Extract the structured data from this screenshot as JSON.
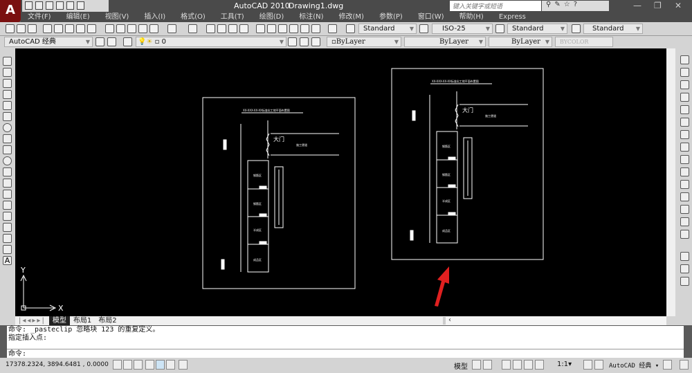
{
  "app": {
    "logo": "A",
    "title": "AutoCAD 2010",
    "document": "Drawing1.dwg"
  },
  "search": {
    "placeholder": "键入关键字或短语"
  },
  "window_controls": {
    "minimize": "—",
    "restore": "❐",
    "close": "✕"
  },
  "menu": [
    "文件(F)",
    "编辑(E)",
    "视图(V)",
    "插入(I)",
    "格式(O)",
    "工具(T)",
    "绘图(D)",
    "标注(N)",
    "修改(M)",
    "参数(P)",
    "窗口(W)",
    "帮助(H)",
    "Express"
  ],
  "styles": {
    "text_style": "Standard",
    "dim_style": "ISO-25",
    "table_style": "Standard",
    "mleader_style": "Standard"
  },
  "properties": {
    "workspace": "AutoCAD 经典",
    "layer": "0",
    "color": "ByLayer",
    "linetype": "ByLayer",
    "lineweight": "ByLayer",
    "plotstyle": "BYCOLOR"
  },
  "ucs": {
    "x": "X",
    "y": "Y"
  },
  "drawing": {
    "title": "XX-XXX-XX-XX标准化工地平面布置图",
    "gate": "大门",
    "road": "施工便道",
    "zones": [
      "钢筋区",
      "钢筋区",
      "半成区",
      "成品区"
    ]
  },
  "tabs": [
    "模型",
    "布局1",
    "布局2"
  ],
  "command": {
    "history": [
      "命令: _pasteclip 忽略块 123 的重复定义。",
      "指定插入点:"
    ],
    "prompt": "命令:"
  },
  "status": {
    "coordinates": "17378.2324, 3894.6481 , 0.0000",
    "model": "模型",
    "annotation_scale": "1:1▾",
    "workspace": "AutoCAD 经典 ▾"
  },
  "colors": {
    "canvas": "#000000",
    "arrow": "#e02020"
  }
}
